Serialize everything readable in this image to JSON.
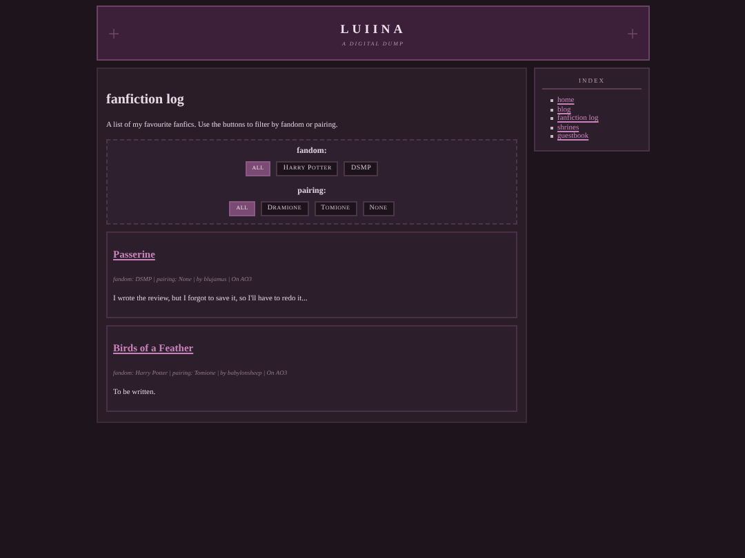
{
  "header": {
    "title": "LUIINA",
    "subtitle": "A DIGITAL DUMP"
  },
  "main": {
    "heading": "fanfiction log",
    "intro": "A list of my favourite fanfics. Use the buttons to filter by fandom or pairing.",
    "filters": [
      {
        "label": "fandom:",
        "options": [
          {
            "label": "all",
            "selected": true
          },
          {
            "label": "Harry Potter",
            "selected": false
          },
          {
            "label": "DSMP",
            "selected": false
          }
        ]
      },
      {
        "label": "pairing:",
        "options": [
          {
            "label": "all",
            "selected": true
          },
          {
            "label": "Dramione",
            "selected": false
          },
          {
            "label": "Tomione",
            "selected": false
          },
          {
            "label": "None",
            "selected": false
          }
        ]
      }
    ],
    "entries": [
      {
        "title": "Passerine",
        "meta": "fandom: DSMP | pairing: None | by blujamus | On AO3",
        "review": "I wrote the review, but I forgot to save it, so I'll have to redo it..."
      },
      {
        "title": "Birds of a Feather",
        "meta": "fandom: Harry Potter | pairing: Tomione | by babylonsheep | On AO3",
        "review": "To be written."
      }
    ]
  },
  "sidebar": {
    "title": "INDEX",
    "links": [
      "home",
      "blog",
      "fanfiction log",
      "shrines",
      "guestbook"
    ]
  }
}
